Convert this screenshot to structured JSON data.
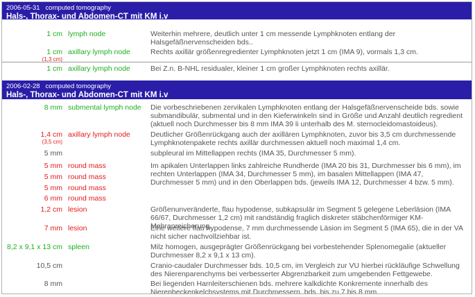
{
  "studies": [
    {
      "date": "2006-05-31",
      "modality": "computed tomography",
      "title": "Hals-, Thorax- und Abdomen-CT mit KM i.v",
      "findings": [
        {
          "size": "1 cm",
          "size_color": "green",
          "label": "lymph node",
          "label_color": "green",
          "desc": "Weiterhin mehrere, deutlich unter 1 cm messende Lymphknoten entlang der Halsgefäßnervenscheiden bds.."
        },
        {
          "size": "1 cm",
          "size_color": "green",
          "prev": "(1,3 cm)",
          "label": "axillary lymph node",
          "label_color": "green",
          "desc": "Rechts axillär größenregredienter Lymphknoten jetzt 1 cm (IMA 9), vormals 1,3 cm."
        },
        {
          "size": "1 cm",
          "size_color": "green",
          "label": "axillary lymph node",
          "label_color": "green",
          "desc": "Bei Z.n. B-NHL residualer, kleiner 1 cm großer Lymphknoten rechts axillär."
        }
      ]
    },
    {
      "date": "2006-02-28",
      "modality": "computed tomography",
      "title": "Hals-, Thorax- und Abdomen-CT mit KM i.v",
      "findings": [
        {
          "size": "8 mm",
          "size_color": "green",
          "label": "submental lymph node",
          "label_color": "green",
          "desc": "Die vorbeschriebenen zervikalen Lymphknoten entlang der Halsgefäßnervenscheide bds. sowie submandibulär, submental und in den Kieferwinkeln sind in Größe und Anzahl deutlich regredient (aktuell noch Durchmesser bis 8 mm IMA 39 li unterhalb des M. sternocleidomastoideus)."
        },
        {
          "size": "1,4 cm",
          "size_color": "red",
          "prev": "(3,5 cm)",
          "label": "axillary lymph node",
          "label_color": "red",
          "desc": "Deutlicher Größenrückgang auch der axillären Lymphknoten, zuvor bis 3,5 cm durchmessende Lymphknotenpakete rechts axillär durchmessen aktuell noch maximal 1,4 cm."
        },
        {
          "size": "5 mm",
          "size_color": "gray",
          "label": "",
          "label_color": "gray",
          "desc": "subpleural im Mittellappen rechts (IMA 35, Durchmesser 5 mm)."
        },
        {
          "size": "5 mm",
          "size_color": "red",
          "label": "round mass",
          "label_color": "red",
          "desc": "Im apikalen Unterlappen links zahlreiche Rundherde (IMA 20 bis 31, Durchmesser bis 6 mm), im rechten Unterlappen (IMA 34, Durchmesser 5 mm), im basalen Mittellappen (IMA 47, Durchmesser 5 mm) und in den Oberlappen bds. (jeweils IMA 12, Durchmesser 4 bzw. 5 mm)."
        },
        {
          "size": "5 mm",
          "size_color": "red",
          "label": "round mass",
          "label_color": "red",
          "desc": ""
        },
        {
          "size": "5 mm",
          "size_color": "red",
          "label": "round mass",
          "label_color": "red",
          "desc": ""
        },
        {
          "size": "6 mm",
          "size_color": "red",
          "label": "round mass",
          "label_color": "red",
          "desc": ""
        },
        {
          "size": "1,2 cm",
          "size_color": "red",
          "label": "lesion",
          "label_color": "red",
          "desc": "Größenunveränderte, flau hypodense, subkapsulär im Segment 5 gelegene Leberläsion (IMA 66/67, Durchmesser 1,2 cm) mit randständig fraglich diskreter stäbchenförmiger KM-Mehranreicherung."
        },
        {
          "size": "7 mm",
          "size_color": "red",
          "label": "lesion",
          "label_color": "red",
          "desc": "Eine weitere flau hypodense, 7 mm durchmessende Läsion im Segment 5 (IMA 65), die in der VA nicht sicher nachvollziehbar ist."
        },
        {
          "size": "8,2 x 9,1 x 13 cm",
          "size_color": "green",
          "label": "spleen",
          "label_color": "green",
          "desc": "Milz homogen, ausgeprägter Größenrückgang bei vorbestehender Splenomegalie (aktueller Durchmesser 8,2 x 9,1 x 13 cm)."
        },
        {
          "size": "10,5 cm",
          "size_color": "gray",
          "label": "",
          "label_color": "gray",
          "desc": "Cranio-caudaler Durchmesser bds. 10,5 cm, im Vergleich zur VU hierbei rückläufige Schwellung des Nierenparenchyms bei verbesserter Abgrenzbarkeit zum umgebenden Fettgewebe."
        },
        {
          "size": "8 mm",
          "size_color": "gray",
          "label": "",
          "label_color": "gray",
          "desc": "Bei liegenden Harnleiterschienen bds. mehrere kalkdichte Konkremente innerhalb des Nierenbeckenkelchsystems mit Durchmessern, bds. bis zu 7 bis 8 mm."
        }
      ]
    }
  ]
}
